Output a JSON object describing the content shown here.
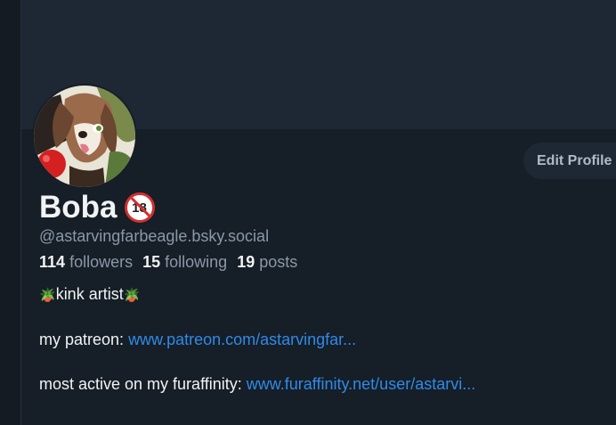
{
  "profile": {
    "display_name": "Boba",
    "age_badge": "18",
    "handle": "@astarvingfarbeagle.bsky.social",
    "edit_button_label": "Edit Profile",
    "stats": {
      "followers_count": "114",
      "followers_label": "followers",
      "following_count": "15",
      "following_label": "following",
      "posts_count": "19",
      "posts_label": "posts"
    },
    "bio": {
      "line1_emoji": "🪴",
      "line1_text": "kink artist",
      "patreon_prefix": "my patreon:",
      "patreon_link": "www.patreon.com/astarvingfar...",
      "furaffinity_prefix": "most active on my furaffinity:",
      "furaffinity_link": "www.furaffinity.net/user/astarvi..."
    }
  },
  "colors": {
    "background": "#161e27",
    "banner": "#1e2835",
    "text_primary": "#f1f3f5",
    "text_secondary": "#8a98a8",
    "link": "#2f8be8",
    "badge_red": "#d42f2f"
  }
}
